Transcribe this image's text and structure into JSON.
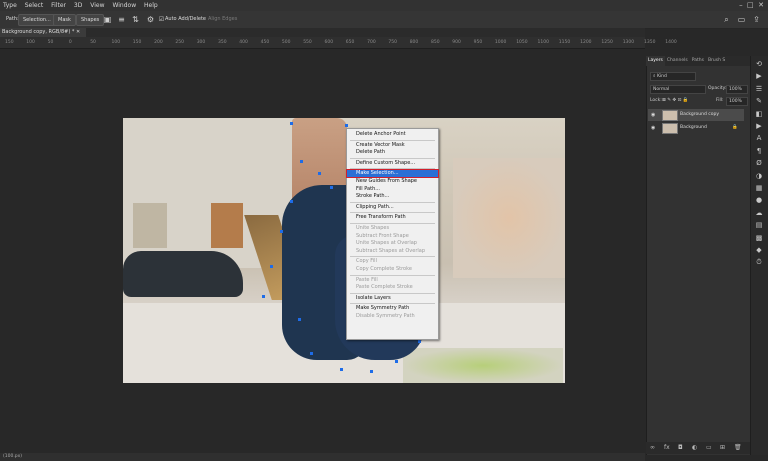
{
  "menubar": [
    "Type",
    "Select",
    "Filter",
    "3D",
    "View",
    "Window",
    "Help"
  ],
  "optionsbar": {
    "path_label": "Path:",
    "selection_btn": "Selection...",
    "mask_btn": "Mask",
    "shapes_btn": "Shapes",
    "auto_add_delete": "Auto Add/Delete",
    "align_edges": "Align Edges"
  },
  "document_tab": "Background copy, RGB/8#) *",
  "ruler_ticks": [
    "150",
    "100",
    "50",
    "0",
    "50",
    "100",
    "150",
    "200",
    "250",
    "300",
    "350",
    "400",
    "450",
    "500",
    "550",
    "600",
    "650",
    "700",
    "750",
    "800",
    "850",
    "900",
    "950",
    "1000",
    "1050",
    "1100",
    "1150",
    "1200",
    "1250",
    "1300",
    "1350",
    "1400"
  ],
  "context_menu": {
    "items": [
      {
        "label": "Delete Anchor Point",
        "disabled": false,
        "selected": false
      },
      {
        "label": "Create Vector Mask",
        "disabled": false,
        "selected": false
      },
      {
        "label": "Delete Path",
        "disabled": false,
        "selected": false
      },
      {
        "label": "Define Custom Shape...",
        "disabled": false,
        "selected": false
      },
      {
        "label": "Make Selection...",
        "disabled": false,
        "selected": true
      },
      {
        "label": "New Guides From Shape",
        "disabled": false,
        "selected": false
      },
      {
        "label": "Fill Path...",
        "disabled": false,
        "selected": false
      },
      {
        "label": "Stroke Path...",
        "disabled": false,
        "selected": false
      },
      {
        "label": "Clipping Path...",
        "disabled": false,
        "selected": false
      },
      {
        "label": "Free Transform Path",
        "disabled": false,
        "selected": false
      },
      {
        "label": "Unite Shapes",
        "disabled": true,
        "selected": false
      },
      {
        "label": "Subtract Front Shape",
        "disabled": true,
        "selected": false
      },
      {
        "label": "Unite Shapes at Overlap",
        "disabled": true,
        "selected": false
      },
      {
        "label": "Subtract Shapes at Overlap",
        "disabled": true,
        "selected": false
      },
      {
        "label": "Copy Fill",
        "disabled": true,
        "selected": false
      },
      {
        "label": "Copy Complete Stroke",
        "disabled": true,
        "selected": false
      },
      {
        "label": "Paste Fill",
        "disabled": true,
        "selected": false
      },
      {
        "label": "Paste Complete Stroke",
        "disabled": true,
        "selected": false
      },
      {
        "label": "Isolate Layers",
        "disabled": false,
        "selected": false
      },
      {
        "label": "Make Symmetry Path",
        "disabled": false,
        "selected": false
      },
      {
        "label": "Disable Symmetry Path",
        "disabled": true,
        "selected": false
      }
    ]
  },
  "layers_panel": {
    "tabs": [
      "Layers",
      "Channels",
      "Paths",
      "Brush S"
    ],
    "kind_label": "Kind",
    "blend_mode": "Normal",
    "opacity_label": "Opacity:",
    "opacity_value": "100%",
    "lock_label": "Lock:",
    "fill_label": "Fill:",
    "fill_value": "100%",
    "layers": [
      {
        "name": "Background copy",
        "selected": true,
        "locked": false
      },
      {
        "name": "Background",
        "selected": false,
        "locked": true
      }
    ]
  },
  "status": "(100.px)",
  "colors": {
    "selected_item": "#2b6fd5",
    "highlight_outline": "#d21f2c"
  }
}
